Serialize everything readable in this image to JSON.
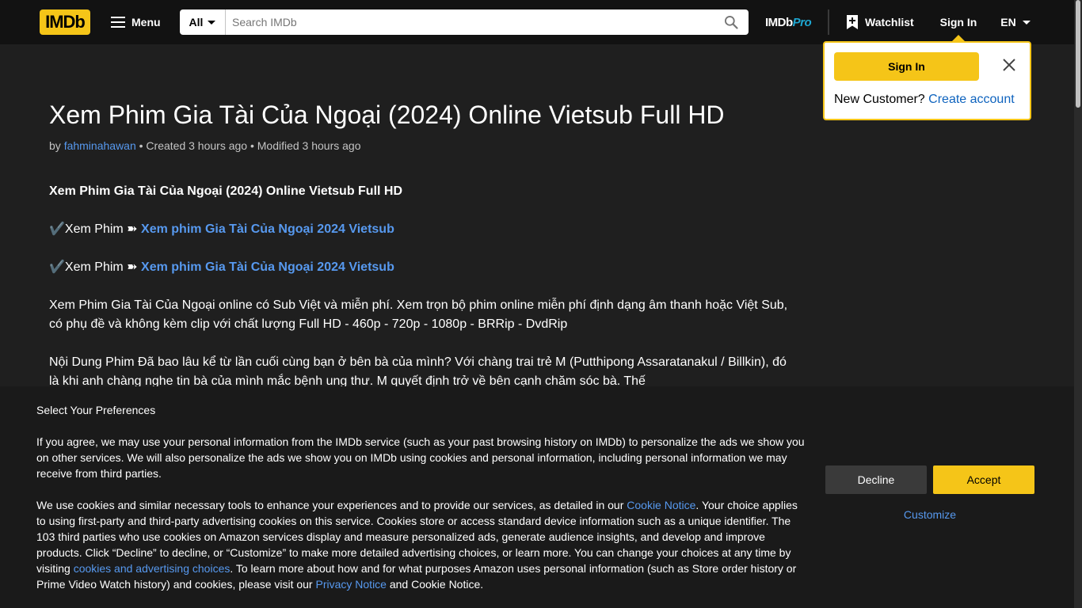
{
  "header": {
    "logo": "IMDb",
    "menu_label": "Menu",
    "search_category": "All",
    "search_placeholder": "Search IMDb",
    "imdbpro_a": "IMDb",
    "imdbpro_b": "Pro",
    "watchlist_label": "Watchlist",
    "signin_label": "Sign In",
    "language": "EN"
  },
  "popover": {
    "signin_button": "Sign In",
    "new_customer": "New Customer?",
    "create_account": "Create account"
  },
  "article": {
    "title": "Xem Phim Gia Tài Của Ngoại (2024) Online Vietsub Full HD",
    "by": "by",
    "author": "fahminahawan",
    "created": "• Created 3 hours ago • Modified 3 hours ago",
    "heading": "Xem Phim Gia Tài Của Ngoại (2024) Online Vietsub Full HD",
    "link_prefix": "✔️Xem Phim ➽",
    "link_1": "Xem phim Gia Tài Của Ngoại 2024 Vietsub",
    "link_2": "Xem phim Gia Tài Của Ngoại 2024 Vietsub",
    "paragraph_1": "Xem Phim Gia Tài Của Ngoại online có Sub Việt và miễn phí. Xem trọn bộ phim online miễn phí định dạng âm thanh hoặc Việt Sub, có phụ đề và không kèm clip với chất lượng Full HD - 460p - 720p - 1080p - BRRip - DvdRip",
    "paragraph_2": "Nội Dung Phim Đã bao lâu kể từ lần cuối cùng bạn ở bên bà của mình? Với chàng trai trẻ M (Putthipong Assaratanakul / Billkin), đó là khi anh chàng nghe tin bà của mình mắc bệnh ung thư. M quyết định trở về bên cạnh chăm sóc bà. Thế"
  },
  "cookie": {
    "title": "Select Your Preferences",
    "p1": "If you agree, we may use your personal information from the IMDb service (such as your past browsing history on IMDb) to personalize the ads we show you on other services. We will also personalize the ads we show you on IMDb using cookies and personal information, including personal information we may receive from third parties.",
    "p2_a": "We use cookies and similar necessary tools to enhance your experiences and to provide our services, as detailed in our ",
    "cookie_notice_link": "Cookie Notice",
    "p2_b": ". Your choice applies to using first-party and third-party advertising cookies on this service. Cookies store or access standard device information such as a unique identifier. The 103 third parties who use cookies on Amazon services display and measure personalized ads, generate audience insights, and develop and improve products. Click “Decline” to decline, or “Customize” to make more detailed advertising choices, or learn more. You can change your choices at any time by visiting ",
    "cookies_choices_link": "cookies and advertising choices",
    "p2_c": ". To learn more about how and for what purposes Amazon uses personal information (such as Store order history or Prime Video Watch history) and cookies, please visit our ",
    "privacy_link": "Privacy Notice",
    "p2_d": " and Cookie Notice.",
    "decline": "Decline",
    "accept": "Accept",
    "customize": "Customize"
  },
  "colors": {
    "brand_yellow": "#f5c518",
    "link_blue": "#5799ef",
    "background": "#1f1f1f",
    "header_bg": "#121212"
  },
  "icons": [
    "hamburger-icon",
    "caret-down-icon",
    "search-icon",
    "watchlist-add-icon",
    "close-icon"
  ]
}
